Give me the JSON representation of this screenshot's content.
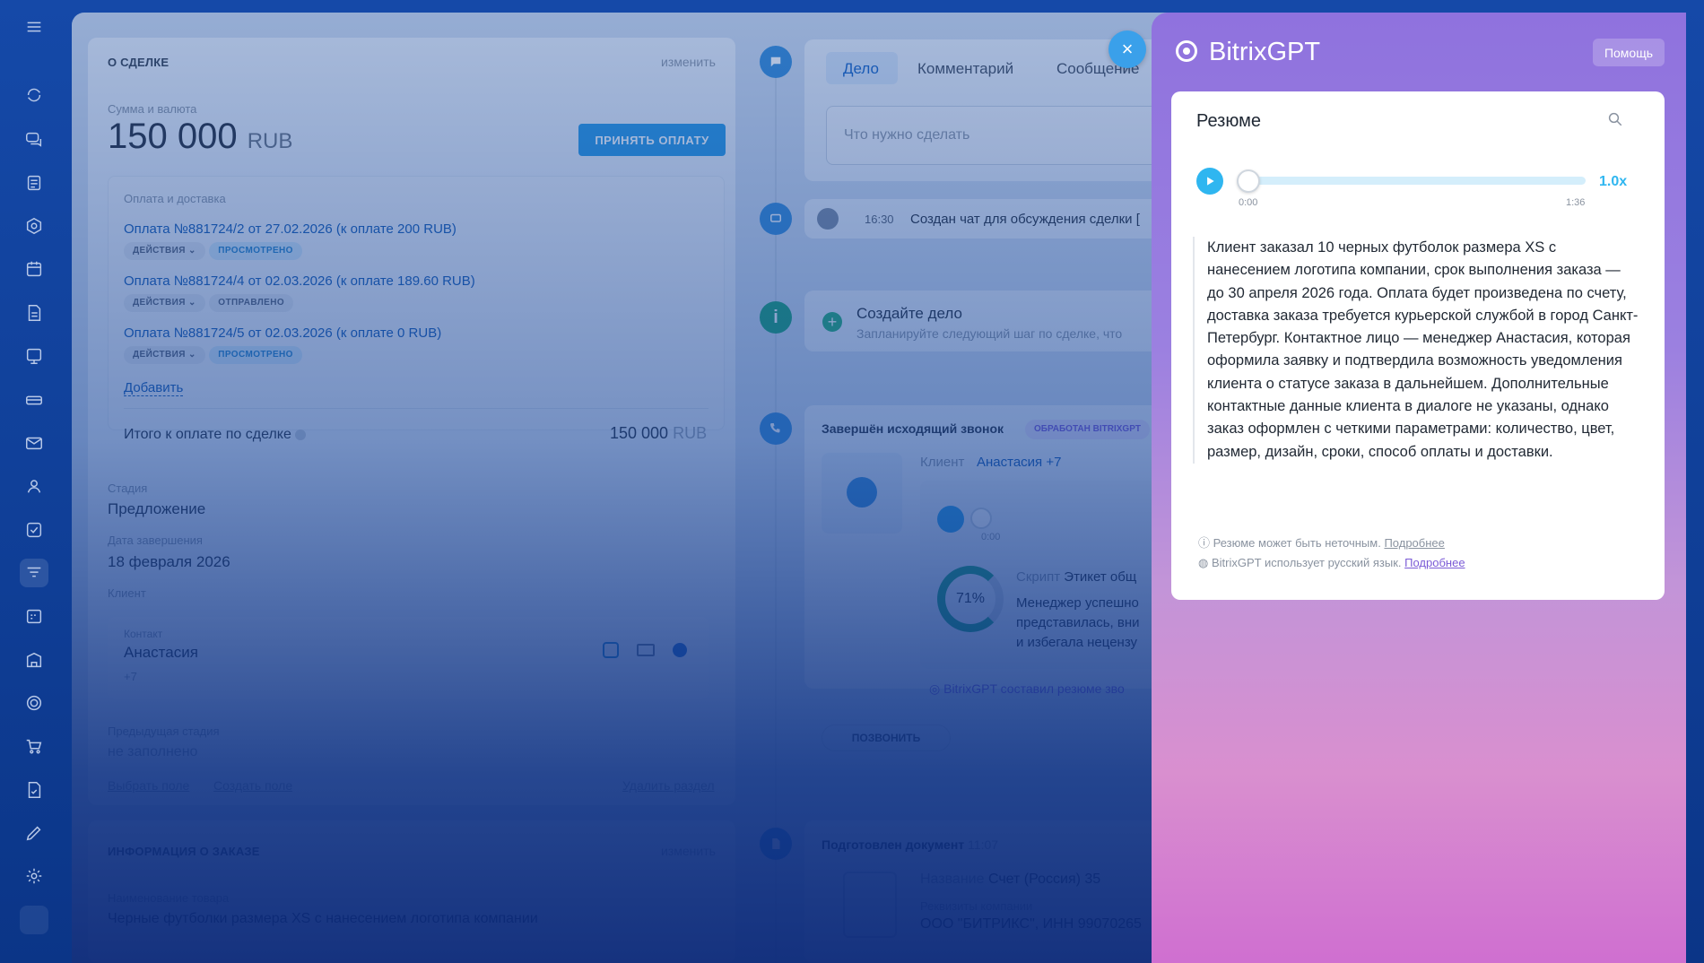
{
  "deal": {
    "section_title": "О СДЕЛКЕ",
    "edit_label": "изменить",
    "amount_label": "Сумма и валюта",
    "amount_value": "150 000",
    "amount_currency": "RUB",
    "accept_payment_button": "ПРИНЯТЬ ОПЛАТУ",
    "payments_title": "Оплата и доставка",
    "payments": [
      {
        "link": "Оплата №881724/2 от 27.02.2026 (к оплате 200 RUB)",
        "actions": "ДЕЙСТВИЯ",
        "status": "ПРОСМОТРЕНО"
      },
      {
        "link": "Оплата №881724/4 от 02.03.2026 (к оплате 189.60 RUB)",
        "actions": "ДЕЙСТВИЯ",
        "status": "ОТПРАВЛЕНО"
      },
      {
        "link": "Оплата №881724/5 от 02.03.2026 (к оплате 0 RUB)",
        "actions": "ДЕЙСТВИЯ",
        "status": "ПРОСМОТРЕНО"
      }
    ],
    "add_label": "Добавить",
    "total_label": "Итого к оплате по сделке",
    "total_value": "150 000",
    "total_currency": "RUB",
    "stage_label": "Стадия",
    "stage_value": "Предложение",
    "close_date_label": "Дата завершения",
    "close_date_value": "18 февраля 2026",
    "client_label": "Клиент",
    "contact_label": "Контакт",
    "contact_name": "Анастасия",
    "contact_phone": "+7",
    "prev_stage_label": "Предыдущая стадия",
    "prev_stage_value": "не заполнено",
    "select_field": "Выбрать поле",
    "create_field": "Создать поле",
    "delete_section": "Удалить раздел",
    "order_section_title": "ИНФОРМАЦИЯ О ЗАКАЗЕ",
    "order_edit_label": "изменить",
    "product_label": "Наименование товара",
    "product_value": "Черные футболки размера XS с нанесением логотипа компании"
  },
  "timeline": {
    "tabs": [
      "Дело",
      "Комментарий",
      "Сообщение"
    ],
    "task_placeholder": "Что нужно сделать",
    "chat_time": "16:30",
    "chat_text": "Создан чат для обсуждения сделки [",
    "create_task_title": "Создайте дело",
    "create_task_sub": "Запланируйте следующий шаг по сделке, что",
    "call_title": "Завершён исходящий звонок",
    "call_badge": "ОБРАБОТАН BITRIXGPT",
    "call_client_label": "Клиент",
    "call_client_value": "Анастасия +7",
    "call_player_time": "0:00",
    "script_label": "Скрипт",
    "script_value": "Этикет общ",
    "score": "71%",
    "script_text": "Менеджер успешно представилась, вни и избегала нецензу",
    "gpt_summary_note": "BitrixGPT составил резюме зво",
    "call_button": "ПОЗВОНИТЬ",
    "doc_title": "Подготовлен документ",
    "doc_time": "11:07",
    "doc_name_label": "Название",
    "doc_name_value": "Счет (Россия) 35",
    "doc_requisites_label": "Реквизиты компании",
    "doc_requisites_value": "ООО \"БИТРИКС\", ИНН 99070265"
  },
  "gpt": {
    "title": "BitrixGPT",
    "help_button": "Помощь",
    "close_icon": "×",
    "card_title": "Резюме",
    "player_start": "0:00",
    "player_end": "1:36",
    "player_speed": "1.0x",
    "player_progress": 0,
    "summary": "Клиент заказал 10 черных футболок размера XS с нанесением логотипа компании, срок выполнения заказа — до 30 апреля 2026 года. Оплата будет произведена по счету, доставка заказа требуется курьерской службой в город Санкт-Петербург. Контактное лицо — менеджер Анастасия, которая оформила заявку и подтвердила возможность уведомления клиента о статусе заказа в дальнейшем. Дополнительные контактные данные клиента в диалоге не указаны, однако заказ оформлен с четкими параметрами: количество, цвет, размер, дизайн, сроки, способ оплаты и доставки.",
    "note1_text": "Резюме может быть неточным.",
    "note1_link": "Подробнее",
    "note2_text": "BitrixGPT использует русский язык.",
    "note2_link": "Подробнее",
    "accent": "#2fb6f0"
  },
  "sidebar_icons": [
    "menu-icon",
    "sync-icon",
    "chat-icon",
    "feed-icon",
    "circle-icon",
    "calendar-icon",
    "document-icon",
    "board-icon",
    "storage-icon",
    "mail-icon",
    "group-icon",
    "tasks-icon",
    "funnel-icon",
    "schedule-icon",
    "company-icon",
    "target-icon",
    "cart-icon",
    "contract-icon",
    "sign-icon",
    "settings-icon"
  ]
}
